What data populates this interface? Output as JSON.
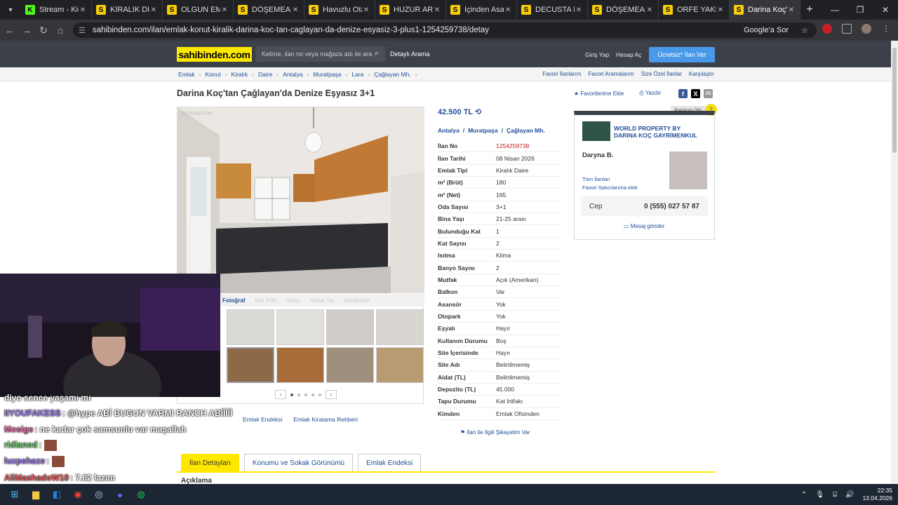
{
  "browser": {
    "tabs": [
      {
        "favicon": "K",
        "title": "Stream - Kick D"
      },
      {
        "favicon": "S",
        "title": "KİRALIK DUBLE"
      },
      {
        "favicon": "S",
        "title": "OLGUN EMLAK"
      },
      {
        "favicon": "S",
        "title": "DÖŞEMEALTI M"
      },
      {
        "favicon": "S",
        "title": "Havuzlu Otant"
      },
      {
        "favicon": "S",
        "title": "HUZUR ARAYA"
      },
      {
        "favicon": "S",
        "title": "İçinden Asansö"
      },
      {
        "favicon": "S",
        "title": "DECUSTA KİRA"
      },
      {
        "favicon": "S",
        "title": "DÖŞEMEALTI A"
      },
      {
        "favicon": "S",
        "title": "ORFE YAKINI M"
      },
      {
        "favicon": "S",
        "title": "Darina Koç'tan"
      }
    ],
    "url": "sahibinden.com/ilan/emlak-konut-kiralik-darina-koc-tan-caglayan-da-denize-esyasiz-3-plus1-1254259738/detay",
    "google_sor": "Google'a Sor"
  },
  "site": {
    "logo": "sahibinden.com",
    "search_placeholder": "Kelime, ilan no veya mağaza adı ile ara",
    "detailed_search": "Detaylı Arama",
    "login": "Giriş Yap",
    "register": "Hesap Aç",
    "post_ad": "Ücretsiz* İlan Ver"
  },
  "breadcrumb": [
    "Emlak",
    "Konut",
    "Kiralık",
    "Daire",
    "Antalya",
    "Muratpaşa",
    "Lara",
    "Çağlayan Mh."
  ],
  "right_links": [
    "Favori İlanlarım",
    "Favori Aramalarım",
    "Size Özel İlanlar",
    "Karşılaştır"
  ],
  "listing": {
    "title": "Darina Koç'tan Çağlayan'da Denize Eşyasız 3+1",
    "fav_label": "Favorilerime Ekle",
    "print_label": "Yazdır",
    "image_id": "#1254259738",
    "media_tabs": [
      "Fotoğraf",
      "İlan Klibi",
      "Video",
      "Sanal Tur",
      "SahiDekor"
    ],
    "links": [
      "Emlak Endeksi",
      "Emlak Kiralama Rehberi"
    ],
    "price": "42.500 TL",
    "location": [
      "Antalya",
      "Muratpaşa",
      "Çağlayan Mh."
    ],
    "details": [
      {
        "k": "İlan No",
        "v": "1254259738"
      },
      {
        "k": "İlan Tarihi",
        "v": "08 Nisan 2026"
      },
      {
        "k": "Emlak Tipi",
        "v": "Kiralık Daire"
      },
      {
        "k": "m² (Brüt)",
        "v": "180"
      },
      {
        "k": "m² (Net)",
        "v": "165"
      },
      {
        "k": "Oda Sayısı",
        "v": "3+1"
      },
      {
        "k": "Bina Yaşı",
        "v": "21-25 arası"
      },
      {
        "k": "Bulunduğu Kat",
        "v": "1"
      },
      {
        "k": "Kat Sayısı",
        "v": "2"
      },
      {
        "k": "Isıtma",
        "v": "Klima"
      },
      {
        "k": "Banyo Sayısı",
        "v": "2"
      },
      {
        "k": "Mutfak",
        "v": "Açık (Amerikan)"
      },
      {
        "k": "Balkon",
        "v": "Var"
      },
      {
        "k": "Asansör",
        "v": "Yok"
      },
      {
        "k": "Otopark",
        "v": "Yok"
      },
      {
        "k": "Eşyalı",
        "v": "Hayır"
      },
      {
        "k": "Kullanım Durumu",
        "v": "Boş"
      },
      {
        "k": "Site İçerisinde",
        "v": "Hayır"
      },
      {
        "k": "Site Adı",
        "v": "Belirtilmemiş"
      },
      {
        "k": "Aidat (TL)",
        "v": "Belirtilmemiş"
      },
      {
        "k": "Depozito (TL)",
        "v": "45.000"
      },
      {
        "k": "Tapu Durumu",
        "v": "Kat İrtifakı"
      },
      {
        "k": "Kimden",
        "v": "Emlak Ofisinden"
      }
    ],
    "complain": "İlan ile İlgili Şikayetim Var"
  },
  "seller": {
    "badge": "Premium Ofis",
    "coin": "2",
    "office": "WORLD PROPERTY BY DARINA KOÇ GAYRİMENKUL",
    "agent": "Daryna B.",
    "all_ads": "Tüm İlanları",
    "fav_seller": "Favori Satıcılarıma ekle",
    "phone_label": "Cep",
    "phone": "0 (555) 027 57 87",
    "message": "Mesaj gönder"
  },
  "bottom_tabs": [
    "İlan Detayları",
    "Konumu ve Sokak Görünümü",
    "Emlak Endeksi"
  ],
  "section_title": "Açıklama",
  "chat": [
    {
      "user": "",
      "msg": "diyo sence yaşamı mı"
    },
    {
      "user": "IIYOUFAKESS",
      "msg": ": @hype ABİ BUGUN VARMI RANCH ABİİİİİ",
      "color": "#a07cf5"
    },
    {
      "user": "Mosige",
      "msg": ": ne kadar çok samsunlu var maşallah",
      "color": "#e86da8"
    },
    {
      "user": "ridianod",
      "msg": ":",
      "color": "#6fd36f"
    },
    {
      "user": "luxpehaze",
      "msg": ":",
      "color": "#a07cf5"
    },
    {
      "user": "AliMashadoW10",
      "msg": ": 7.62 lazım",
      "color": "#f05e5e"
    }
  ],
  "clock": {
    "time": "22:35",
    "date": "13.04.2026"
  }
}
